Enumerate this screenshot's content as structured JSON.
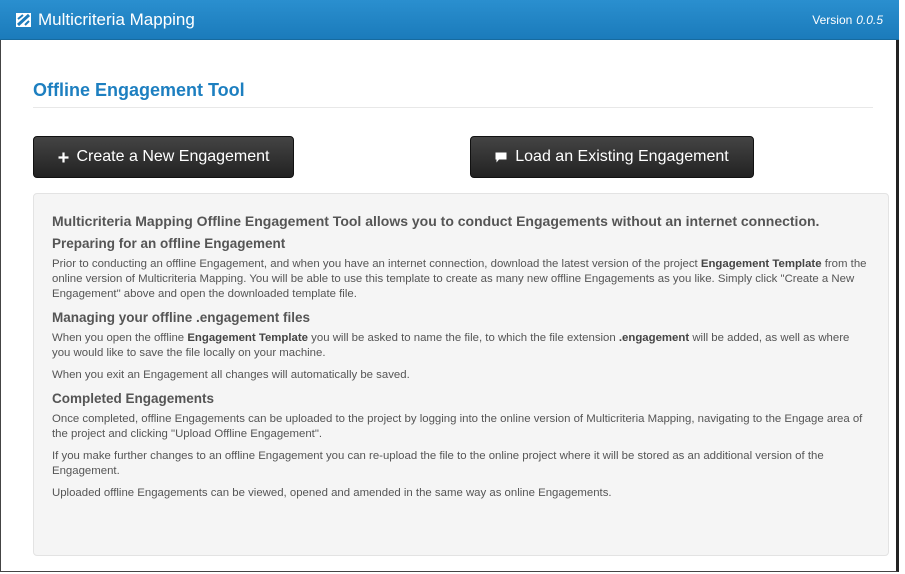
{
  "navbar": {
    "brand": "Multicriteria Mapping",
    "version_label": "Version",
    "version_number": "0.0.5"
  },
  "page": {
    "title": "Offline Engagement Tool"
  },
  "buttons": {
    "create": "Create a New Engagement",
    "load": "Load an Existing Engagement"
  },
  "info": {
    "lead": "Multicriteria Mapping Offline Engagement Tool allows you to conduct Engagements without an internet connection.",
    "preparing_heading": "Preparing for an offline Engagement",
    "preparing_p1_a": "Prior to conducting an offline Engagement, and when you have an internet connection, download the latest version of the project ",
    "preparing_p1_b": "Engagement Template",
    "preparing_p1_c": " from the online version of Multicriteria Mapping. You will be able to use this template to create as many new offline Engagements as you like. Simply click \"Create a New Engagement\" above and open the downloaded template file.",
    "managing_heading": "Managing your offline .engagement files",
    "managing_p1_a": "When you open the offline ",
    "managing_p1_b": "Engagement Template",
    "managing_p1_c": " you will be asked to name the file, to which the file extension ",
    "managing_p1_d": ".engagement",
    "managing_p1_e": " will be added, as well as where you would like to save the file locally on your machine.",
    "managing_p2": "When you exit an Engagement all changes will automatically be saved.",
    "completed_heading": "Completed Engagements",
    "completed_p1": "Once completed, offline Engagements can be uploaded to the project by logging into the online version of Multicriteria Mapping, navigating to the Engage area of the project and clicking \"Upload Offline Engagement\".",
    "completed_p2": "If you make further changes to an offline Engagement you can re-upload the file to the online project where it will be stored as an additional version of the Engagement.",
    "completed_p3": "Uploaded offline Engagements can be viewed, opened and amended in the same way as online Engagements."
  },
  "icons": {
    "brand": "mapping-logo-icon",
    "create": "plus-icon",
    "load": "comment-icon"
  },
  "colors": {
    "navbar": "#1b7bbb",
    "title": "#1d7fc0",
    "button": "#222222",
    "well": "#f5f5f5"
  }
}
